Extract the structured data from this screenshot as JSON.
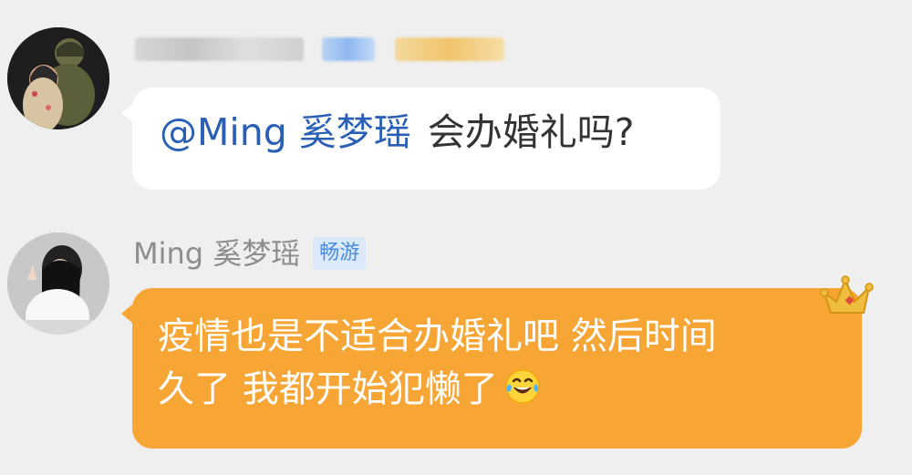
{
  "chat": {
    "messages": [
      {
        "sender_name": "",
        "mention": "@Ming 奚梦瑶",
        "text": "会办婚礼吗?"
      },
      {
        "sender_name": "Ming 奚梦瑶",
        "badge": "畅游",
        "lines": [
          "疫情也是不适合办婚礼吧 然后时间",
          "久了 我都开始犯懒了"
        ],
        "emoji": "tears-of-joy"
      }
    ]
  },
  "colors": {
    "background": "#efefef",
    "mention": "#2a5fb6",
    "orange_bubble": "#f7a534",
    "badge_bg": "#dbe9fb",
    "badge_text": "#4a8ae0"
  },
  "icons": {
    "crown": "crown-icon",
    "emoji": "laughing-tears-emoji-icon"
  }
}
